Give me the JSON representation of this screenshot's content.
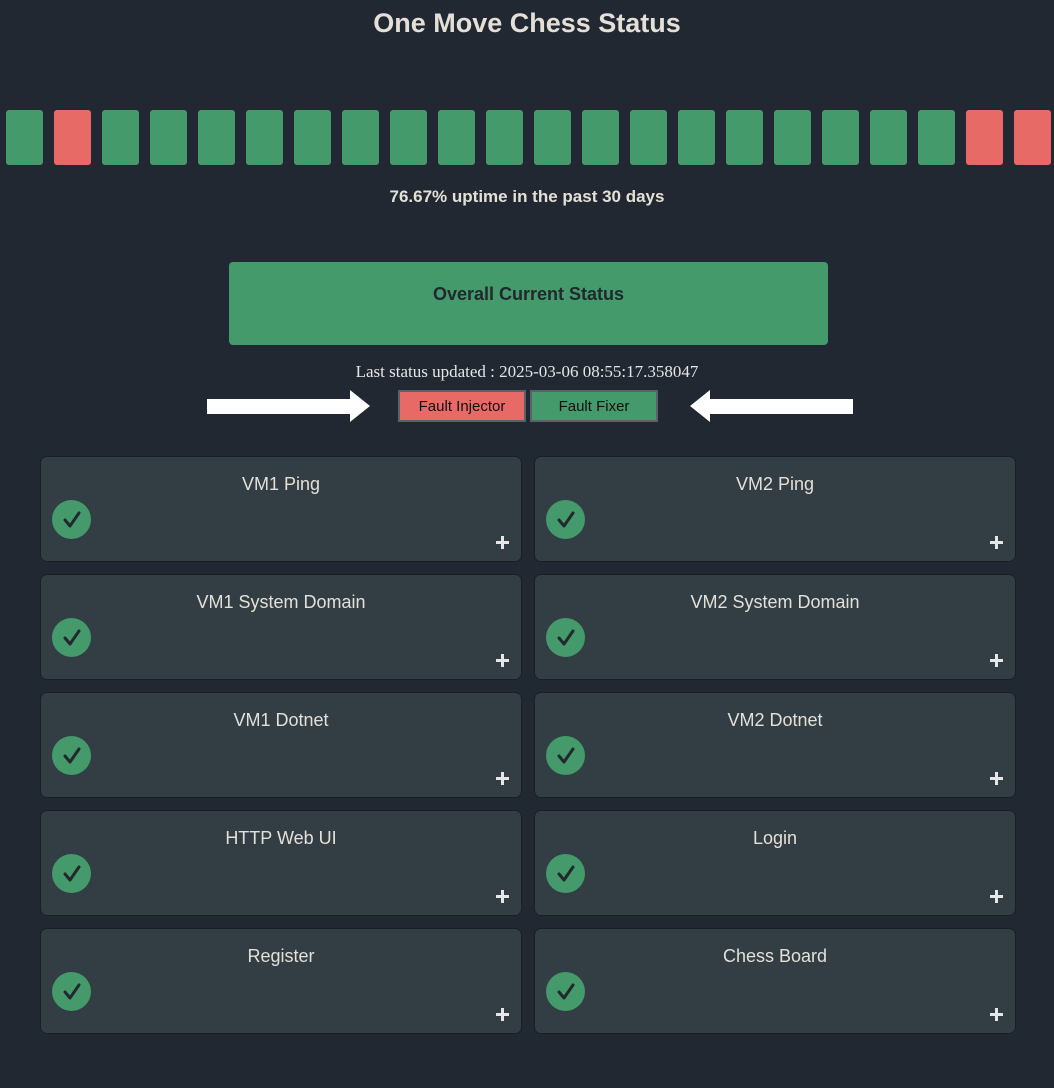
{
  "header": {
    "title": "One Move Chess Status"
  },
  "history": {
    "days": [
      "up",
      "down",
      "up",
      "up",
      "up",
      "up",
      "up",
      "up",
      "up",
      "up",
      "up",
      "up",
      "up",
      "up",
      "up",
      "up",
      "up",
      "up",
      "up",
      "up",
      "down",
      "down"
    ]
  },
  "uptime_text": "76.67% uptime in the past 30 days",
  "overall_status": {
    "label": "Overall Current Status",
    "state": "up"
  },
  "last_updated": "Last status updated : 2025-03-06 08:55:17.358047",
  "controls": {
    "fault_injector_label": "Fault Injector",
    "fault_fixer_label": "Fault Fixer"
  },
  "services": [
    {
      "name": "VM1 Ping",
      "status": "ok"
    },
    {
      "name": "VM2 Ping",
      "status": "ok"
    },
    {
      "name": "VM1 System Domain",
      "status": "ok"
    },
    {
      "name": "VM2 System Domain",
      "status": "ok"
    },
    {
      "name": "VM1 Dotnet",
      "status": "ok"
    },
    {
      "name": "VM2 Dotnet",
      "status": "ok"
    },
    {
      "name": "HTTP Web UI",
      "status": "ok"
    },
    {
      "name": "Login",
      "status": "ok"
    },
    {
      "name": "Register",
      "status": "ok"
    },
    {
      "name": "Chess Board",
      "status": "ok"
    }
  ],
  "colors": {
    "up": "#449a6b",
    "down": "#e86a66",
    "background": "#222831",
    "card": "#323d44"
  },
  "icons": {
    "status_ok": "check-circle-icon",
    "expand": "plus-icon",
    "pointer": "arrow-icon"
  }
}
